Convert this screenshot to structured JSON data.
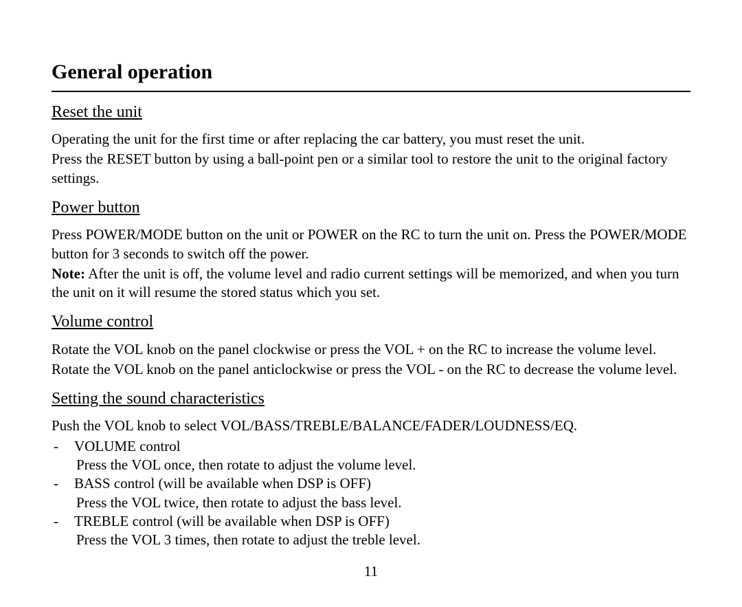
{
  "title": "General operation",
  "sections": {
    "reset": {
      "heading": "Reset the unit",
      "p1": "Operating the unit for the first time or after replacing the car battery, you must reset the unit.",
      "p2": "Press the RESET button by using a ball-point pen or a similar tool to restore the unit to the original factory settings."
    },
    "power": {
      "heading": "Power button",
      "p1": "Press POWER/MODE button on the unit or POWER on the RC to turn the unit on. Press the POWER/MODE button for 3 seconds to switch off the power.",
      "note_label": "Note:",
      "note_body": " After the unit is off, the volume level and radio current settings will be memorized, and when you turn the unit on it will resume the stored status which you set."
    },
    "volume": {
      "heading": "Volume control",
      "p1": "Rotate the VOL knob on the panel clockwise or press the VOL + on the RC to increase the volume level.",
      "p2": "Rotate the VOL knob on the panel anticlockwise or press the VOL - on the RC to decrease the volume level."
    },
    "sound": {
      "heading": "Setting the sound characteristics",
      "p1": "Push the VOL knob to select VOL/BASS/TREBLE/BALANCE/FADER/LOUDNESS/EQ.",
      "items": [
        {
          "label": "VOLUME control",
          "detail": "Press the VOL once, then rotate to adjust the volume level."
        },
        {
          "label": "BASS control (will be available when DSP is OFF)",
          "detail": "Press the VOL twice, then rotate to adjust the bass level."
        },
        {
          "label": "TREBLE control (will be available when DSP is OFF)",
          "detail": "Press the VOL 3 times, then rotate to adjust the treble level."
        }
      ]
    }
  },
  "dash": "-",
  "page_number": "11"
}
